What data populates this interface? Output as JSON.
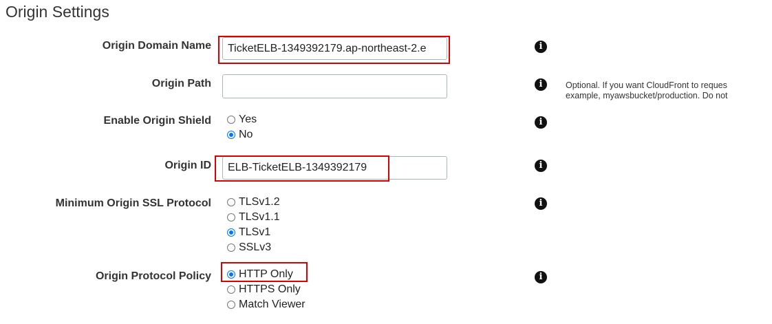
{
  "section": {
    "title": "Origin Settings"
  },
  "fields": {
    "origin_domain_name": {
      "label": "Origin Domain Name",
      "value": "TicketELB-1349392179.ap-northeast-2.e",
      "info_icon": "info-icon"
    },
    "origin_path": {
      "label": "Origin Path",
      "value": "",
      "info_icon": "info-icon",
      "help_line1": "Optional. If you want CloudFront to reques",
      "help_line2": "example, myawsbucket/production. Do not"
    },
    "enable_origin_shield": {
      "label": "Enable Origin Shield",
      "options": [
        "Yes",
        "No"
      ],
      "selected": "No",
      "info_icon": "info-icon"
    },
    "origin_id": {
      "label": "Origin ID",
      "value": "ELB-TicketELB-1349392179",
      "info_icon": "info-icon"
    },
    "minimum_origin_ssl_protocol": {
      "label": "Minimum Origin SSL Protocol",
      "options": [
        "TLSv1.2",
        "TLSv1.1",
        "TLSv1",
        "SSLv3"
      ],
      "selected": "TLSv1",
      "info_icon": "info-icon"
    },
    "origin_protocol_policy": {
      "label": "Origin Protocol Policy",
      "options": [
        "HTTP Only",
        "HTTPS Only",
        "Match Viewer"
      ],
      "selected": "HTTP Only",
      "info_icon": "info-icon"
    }
  },
  "info_glyph": "i",
  "colors": {
    "highlight_border": "#d90000",
    "radio_checked": "#0075ff",
    "info_icon": "#111111"
  }
}
